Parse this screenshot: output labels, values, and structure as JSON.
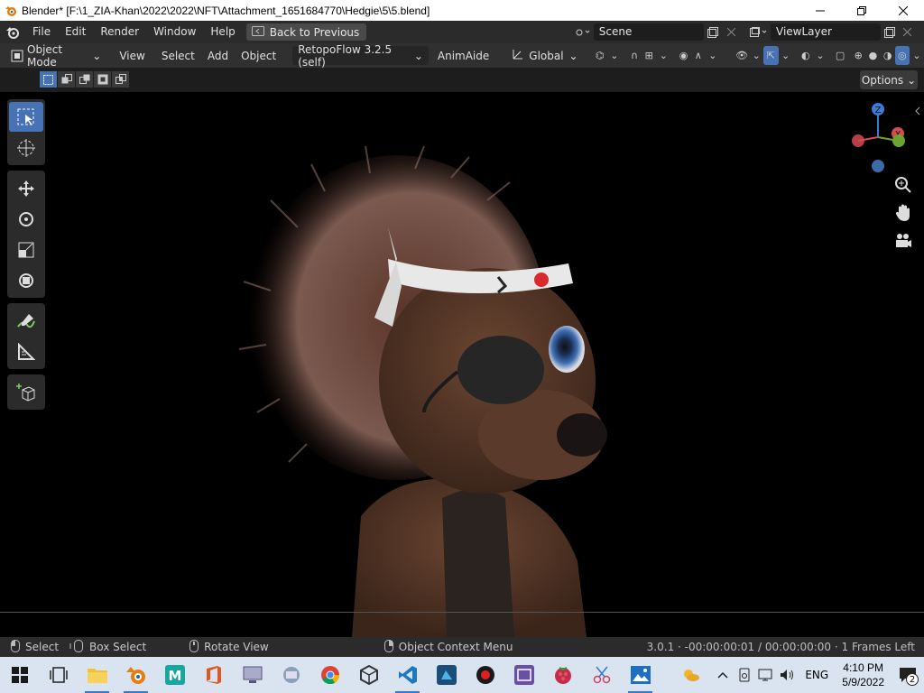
{
  "window": {
    "title": "Blender* [F:\\1_ZIA-Khan\\2022\\2022\\NFT\\Attachment_1651684770\\Hedgie\\5\\5.blend]",
    "controls": [
      "minimize-icon",
      "restore-icon",
      "close-icon"
    ]
  },
  "topbar": {
    "menus": [
      "File",
      "Edit",
      "Render",
      "Window",
      "Help"
    ],
    "back_label": "Back to Previous",
    "scene_name": "Scene",
    "view_layer": "ViewLayer"
  },
  "header": {
    "mode": "Object Mode",
    "menus": [
      "View",
      "Select",
      "Add",
      "Object"
    ],
    "addon": "RetopoFlow 3.2.5 (self)",
    "animaide": "AnimAide",
    "transform_orientation": "Global"
  },
  "toolsettings": {
    "options_label": "Options"
  },
  "toolbar": {
    "tools": [
      "select-box",
      "cursor",
      "move",
      "rotate",
      "scale",
      "transform",
      "annotate",
      "measure",
      "add-cube"
    ],
    "active": "select-box"
  },
  "gizmo": {
    "axes": [
      "Z",
      "X",
      "Y"
    ],
    "colors": {
      "x": "#d64a52",
      "y": "#6aa32e",
      "z": "#3a7bd5"
    }
  },
  "statusbar": {
    "select_label": "Select",
    "box_select_label": "Box Select",
    "rotate_view_label": "Rotate View",
    "context_menu_label": "Object Context Menu",
    "stats": "3.0.1 · -00:00:00:01 / 00:00:00:00 · 1 Frames Left"
  },
  "taskbar": {
    "apps": [
      "windows-start",
      "task-view",
      "file-explorer",
      "blender",
      "maya",
      "office",
      "remote-desktop",
      "rd-client",
      "chrome",
      "unity",
      "vscode",
      "photoshop-express",
      "obs",
      "retopo-tool",
      "raspberry-app",
      "snipping-tool",
      "photos"
    ],
    "language": "ENG",
    "time": "4:10 PM",
    "date": "5/9/2022",
    "notification_count": "2"
  },
  "colors": {
    "accent": "#4772b3",
    "topbar": "#2b2b2b",
    "header": "#303030"
  }
}
